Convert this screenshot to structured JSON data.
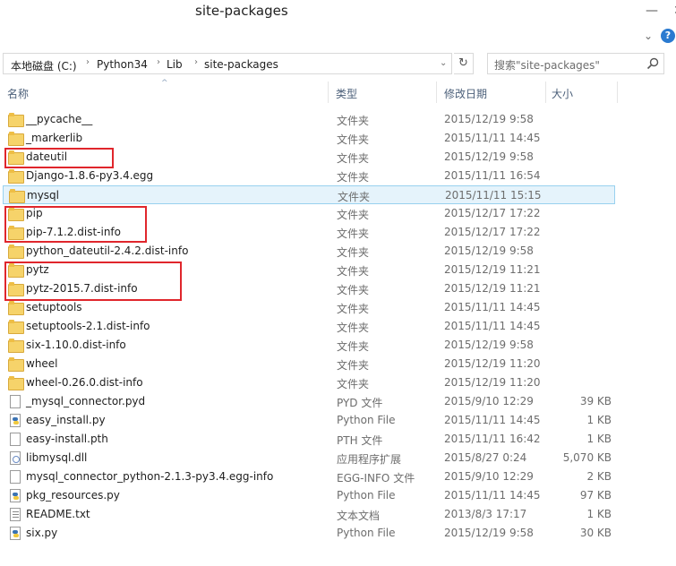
{
  "window": {
    "title": "site-packages",
    "minimize_glyph": "—",
    "close_glyph": "✕"
  },
  "ribbon": {
    "expand_glyph": "⌄",
    "help_glyph": "?"
  },
  "address": {
    "crumbs": [
      "本地磁盘 (C:)",
      "Python34",
      "Lib",
      "site-packages"
    ],
    "separator": "›",
    "dropdown_glyph": "⌄",
    "refresh_glyph": "↻"
  },
  "search": {
    "placeholder": "搜索\"site-packages\""
  },
  "columns": {
    "name": "名称",
    "type": "类型",
    "date": "修改日期",
    "size": "大小",
    "sort_glyph": "^"
  },
  "files": [
    {
      "icon": "folder-icon",
      "name": "__pycache__",
      "type": "文件夹",
      "date": "2015/12/19 9:58",
      "size": ""
    },
    {
      "icon": "folder-icon",
      "name": "_markerlib",
      "type": "文件夹",
      "date": "2015/11/11 14:45",
      "size": ""
    },
    {
      "icon": "folder-icon",
      "name": "dateutil",
      "type": "文件夹",
      "date": "2015/12/19 9:58",
      "size": ""
    },
    {
      "icon": "folder-icon",
      "name": "Django-1.8.6-py3.4.egg",
      "type": "文件夹",
      "date": "2015/11/11 16:54",
      "size": ""
    },
    {
      "icon": "folder-icon",
      "name": "mysql",
      "type": "文件夹",
      "date": "2015/11/11 15:15",
      "size": ""
    },
    {
      "icon": "folder-icon",
      "name": "pip",
      "type": "文件夹",
      "date": "2015/12/17 17:22",
      "size": ""
    },
    {
      "icon": "folder-icon",
      "name": "pip-7.1.2.dist-info",
      "type": "文件夹",
      "date": "2015/12/17 17:22",
      "size": ""
    },
    {
      "icon": "folder-icon",
      "name": "python_dateutil-2.4.2.dist-info",
      "type": "文件夹",
      "date": "2015/12/19 9:58",
      "size": ""
    },
    {
      "icon": "folder-icon",
      "name": "pytz",
      "type": "文件夹",
      "date": "2015/12/19 11:21",
      "size": ""
    },
    {
      "icon": "folder-icon",
      "name": "pytz-2015.7.dist-info",
      "type": "文件夹",
      "date": "2015/12/19 11:21",
      "size": ""
    },
    {
      "icon": "folder-icon",
      "name": "setuptools",
      "type": "文件夹",
      "date": "2015/11/11 14:45",
      "size": ""
    },
    {
      "icon": "folder-icon",
      "name": "setuptools-2.1.dist-info",
      "type": "文件夹",
      "date": "2015/11/11 14:45",
      "size": ""
    },
    {
      "icon": "folder-icon",
      "name": "six-1.10.0.dist-info",
      "type": "文件夹",
      "date": "2015/12/19 9:58",
      "size": ""
    },
    {
      "icon": "folder-icon",
      "name": "wheel",
      "type": "文件夹",
      "date": "2015/12/19 11:20",
      "size": ""
    },
    {
      "icon": "folder-icon",
      "name": "wheel-0.26.0.dist-info",
      "type": "文件夹",
      "date": "2015/12/19 11:20",
      "size": ""
    },
    {
      "icon": "file-icon",
      "name": "_mysql_connector.pyd",
      "type": "PYD 文件",
      "date": "2015/9/10 12:29",
      "size": "39 KB"
    },
    {
      "icon": "python-file-icon",
      "name": "easy_install.py",
      "type": "Python File",
      "date": "2015/11/11 14:45",
      "size": "1 KB"
    },
    {
      "icon": "file-icon",
      "name": "easy-install.pth",
      "type": "PTH 文件",
      "date": "2015/11/11 16:42",
      "size": "1 KB"
    },
    {
      "icon": "dll-icon",
      "name": "libmysql.dll",
      "type": "应用程序扩展",
      "date": "2015/8/27 0:24",
      "size": "5,070 KB"
    },
    {
      "icon": "file-icon",
      "name": "mysql_connector_python-2.1.3-py3.4.egg-info",
      "type": "EGG-INFO 文件",
      "date": "2015/9/10 12:29",
      "size": "2 KB"
    },
    {
      "icon": "python-file-icon",
      "name": "pkg_resources.py",
      "type": "Python File",
      "date": "2015/11/11 14:45",
      "size": "97 KB"
    },
    {
      "icon": "text-file-icon",
      "name": "README.txt",
      "type": "文本文档",
      "date": "2013/8/3 17:17",
      "size": "1 KB"
    },
    {
      "icon": "python-file-icon",
      "name": "six.py",
      "type": "Python File",
      "date": "2015/12/19 9:58",
      "size": "30 KB"
    }
  ],
  "selected_file": "mysql",
  "annotation_color": "#e0262c"
}
